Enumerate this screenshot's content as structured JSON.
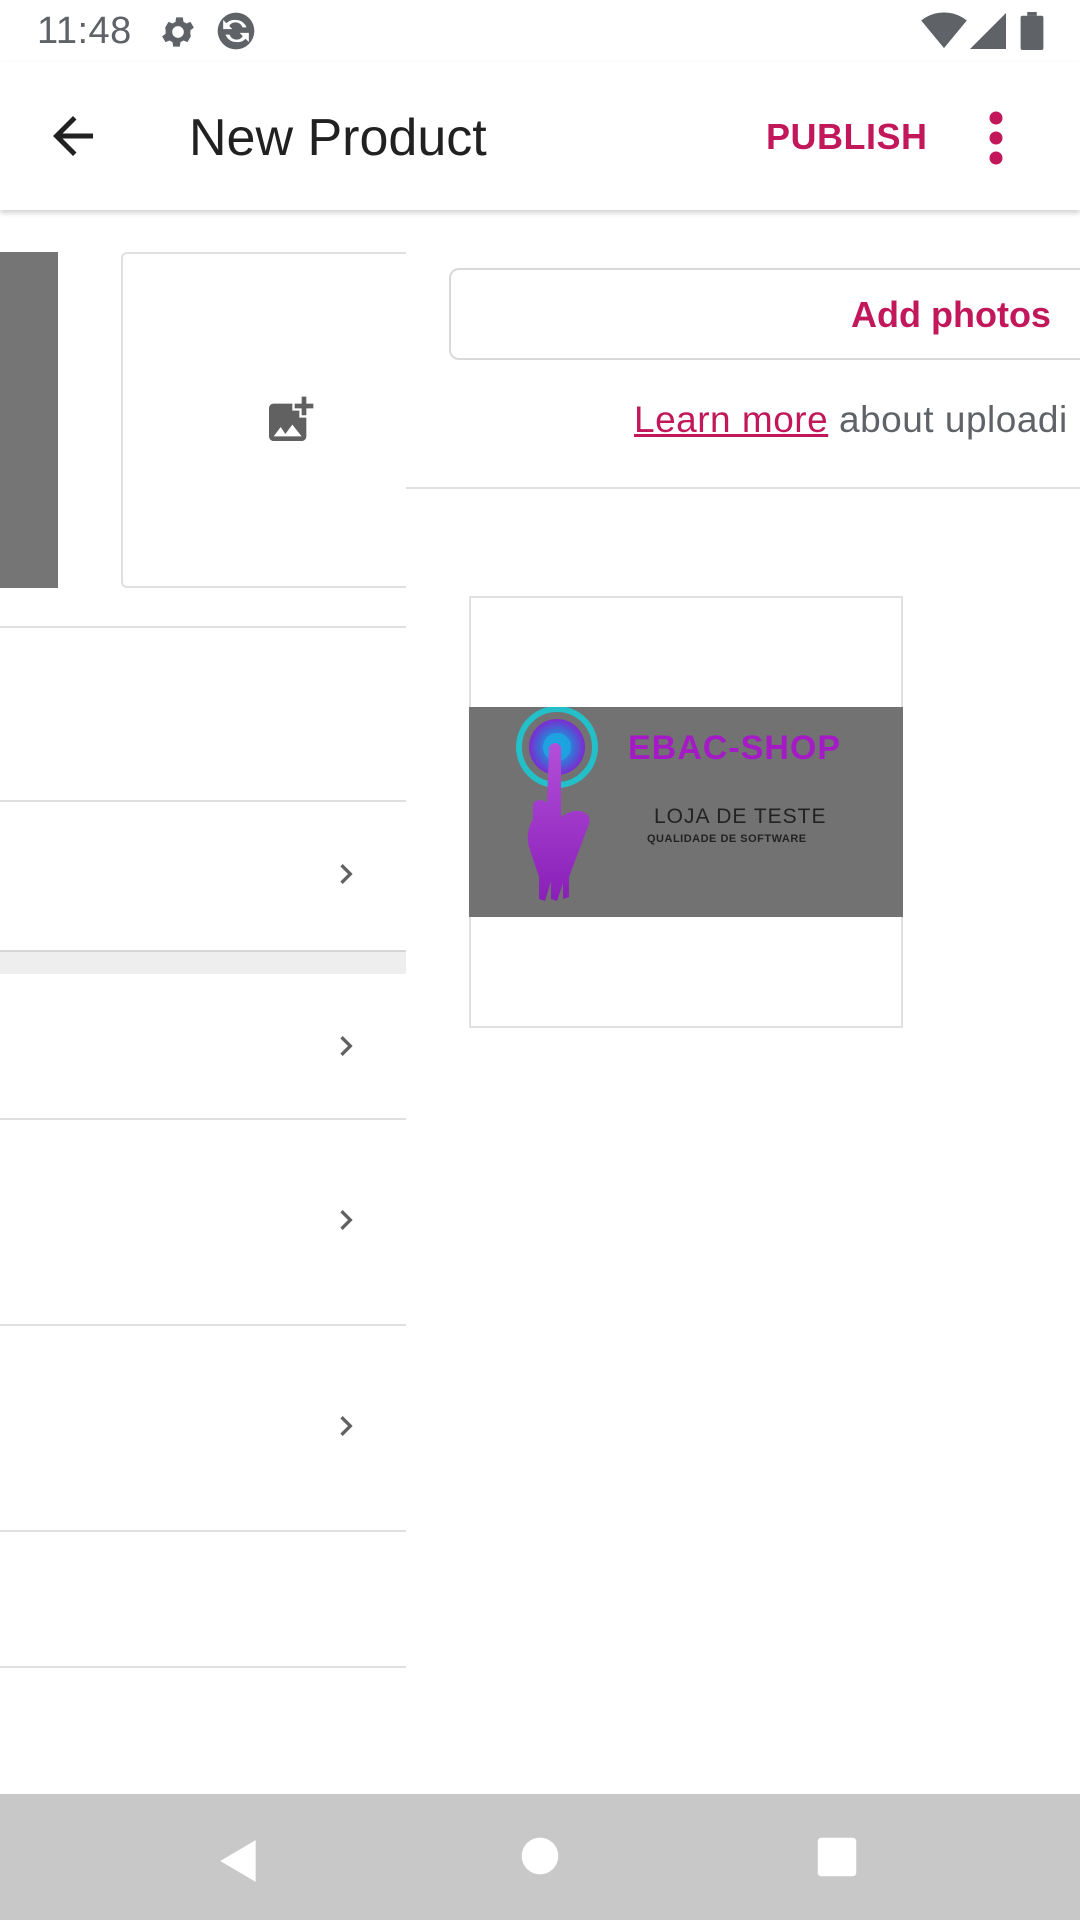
{
  "status_bar": {
    "time": "11:48",
    "icons": [
      "gear-icon",
      "sync-icon",
      "wifi-icon",
      "signal-icon",
      "battery-icon"
    ]
  },
  "app_bar": {
    "title": "New Product",
    "publish_label": "PUBLISH",
    "back_icon": "arrow-back-icon",
    "more_icon": "more-vert-icon"
  },
  "colors": {
    "accent": "#c2185b",
    "nav_bar": "#c8c8c8",
    "divider": "#e0e0e0"
  },
  "drawer": {
    "add_photos_label": "Add photos",
    "learn_more_link": "Learn more",
    "learn_more_rest": " about uploadi"
  },
  "photo": {
    "brand_title": "EBAC-SHOP",
    "line1": "LOJA DE TESTE",
    "line2": "QUALIDADE DE SOFTWARE"
  }
}
